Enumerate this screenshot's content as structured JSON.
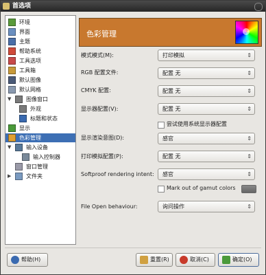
{
  "window": {
    "title": "首选项"
  },
  "sidebar": {
    "items": [
      {
        "label": "环境",
        "icon": "environment-icon",
        "color": "#5a9a3a"
      },
      {
        "label": "界面",
        "icon": "interface-icon",
        "color": "#6a8fc0"
      },
      {
        "label": "主题",
        "icon": "theme-icon",
        "color": "#4a6fa8"
      },
      {
        "label": "帮助系统",
        "icon": "help-system-icon",
        "color": "#d04a3a"
      },
      {
        "label": "工具选项",
        "icon": "tool-options-icon",
        "color": "#c84a4a"
      },
      {
        "label": "工具箱",
        "icon": "toolbox-icon",
        "color": "#c89a3a"
      },
      {
        "label": "默认图像",
        "icon": "default-image-icon",
        "color": "#4a5a78"
      },
      {
        "label": "默认网格",
        "icon": "default-grid-icon",
        "color": "#8a9ab0"
      },
      {
        "label": "图像窗口",
        "icon": "image-window-icon",
        "color": "#7a7a7a"
      },
      {
        "label": "外观",
        "icon": "appearance-icon",
        "color": "#7a7a7a"
      },
      {
        "label": "标题和状态",
        "icon": "title-status-icon",
        "color": "#3a6ab0"
      },
      {
        "label": "显示",
        "icon": "display-icon",
        "color": "#4a9a3a"
      },
      {
        "label": "色彩管理",
        "icon": "color-management-icon",
        "color": "#e0a030"
      },
      {
        "label": "输入设备",
        "icon": "input-devices-icon",
        "color": "#5a7a9a"
      },
      {
        "label": "输入控制器",
        "icon": "input-controllers-icon",
        "color": "#7a8a9a"
      },
      {
        "label": "窗口管理",
        "icon": "window-management-icon",
        "color": "#9a9aa8"
      },
      {
        "label": "文件夹",
        "icon": "folders-icon",
        "color": "#7a9ac0"
      }
    ]
  },
  "banner": {
    "title": "色彩管理"
  },
  "form": {
    "mode_label": "模式模式(M):",
    "mode_value": "打印模拟",
    "rgb_label": "RGB 配置文件:",
    "rgb_value": "配置 无",
    "cmyk_label": "CMYK 配置:",
    "cmyk_value": "配置 无",
    "display_profile_label": "显示器配置(V):",
    "display_profile_value": "配置 无",
    "system_monitor_label": "尝试使用系统显示器配置",
    "display_intent_label": "显示渲染意图(D):",
    "display_intent_value": "感官",
    "printer_profile_label": "打印模拟配置(P):",
    "printer_profile_value": "配置 无",
    "softproof_intent_label": "Softproof rendering intent:",
    "softproof_intent_value": "感官",
    "mark_gamut_label": "Mark out of gamut colors",
    "file_open_label": "File Open behaviour:",
    "file_open_value": "询问操作"
  },
  "buttons": {
    "help": "帮助(H)",
    "reset": "重置(R)",
    "cancel": "取消(C)",
    "ok": "确定(O)"
  },
  "colors": {
    "banner": "#c8782e",
    "selection": "#3d6fb4"
  }
}
